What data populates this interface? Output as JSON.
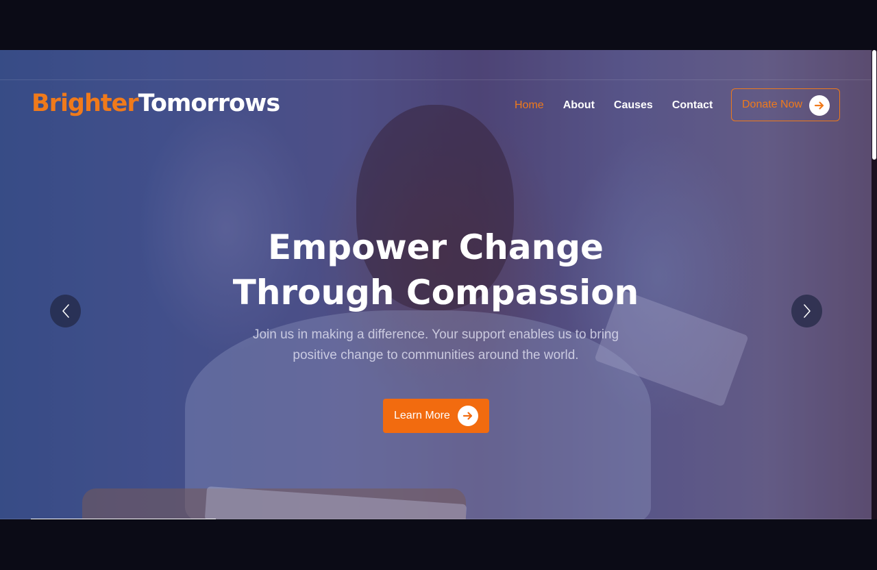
{
  "brand": {
    "part1": "Brighter",
    "part2": "Tomorrows"
  },
  "nav": {
    "items": [
      {
        "label": "Home",
        "active": true
      },
      {
        "label": "About",
        "active": false
      },
      {
        "label": "Causes",
        "active": false
      },
      {
        "label": "Contact",
        "active": false
      }
    ],
    "donate_label": "Donate Now"
  },
  "hero": {
    "title_line1": "Empower Change",
    "title_line2": "Through Compassion",
    "subtitle_line1": "Join us in making a difference. Your support enables us to bring",
    "subtitle_line2": "positive change to communities around the world.",
    "cta_label": "Learn More"
  },
  "slider": {
    "progress": 0.21
  },
  "colors": {
    "accent": "#f07a1b",
    "button": "#f26b0f",
    "text": "#ffffff"
  },
  "icons": {
    "cta": "arrow-right-icon",
    "prev": "chevron-left-icon",
    "next": "chevron-right-icon"
  }
}
